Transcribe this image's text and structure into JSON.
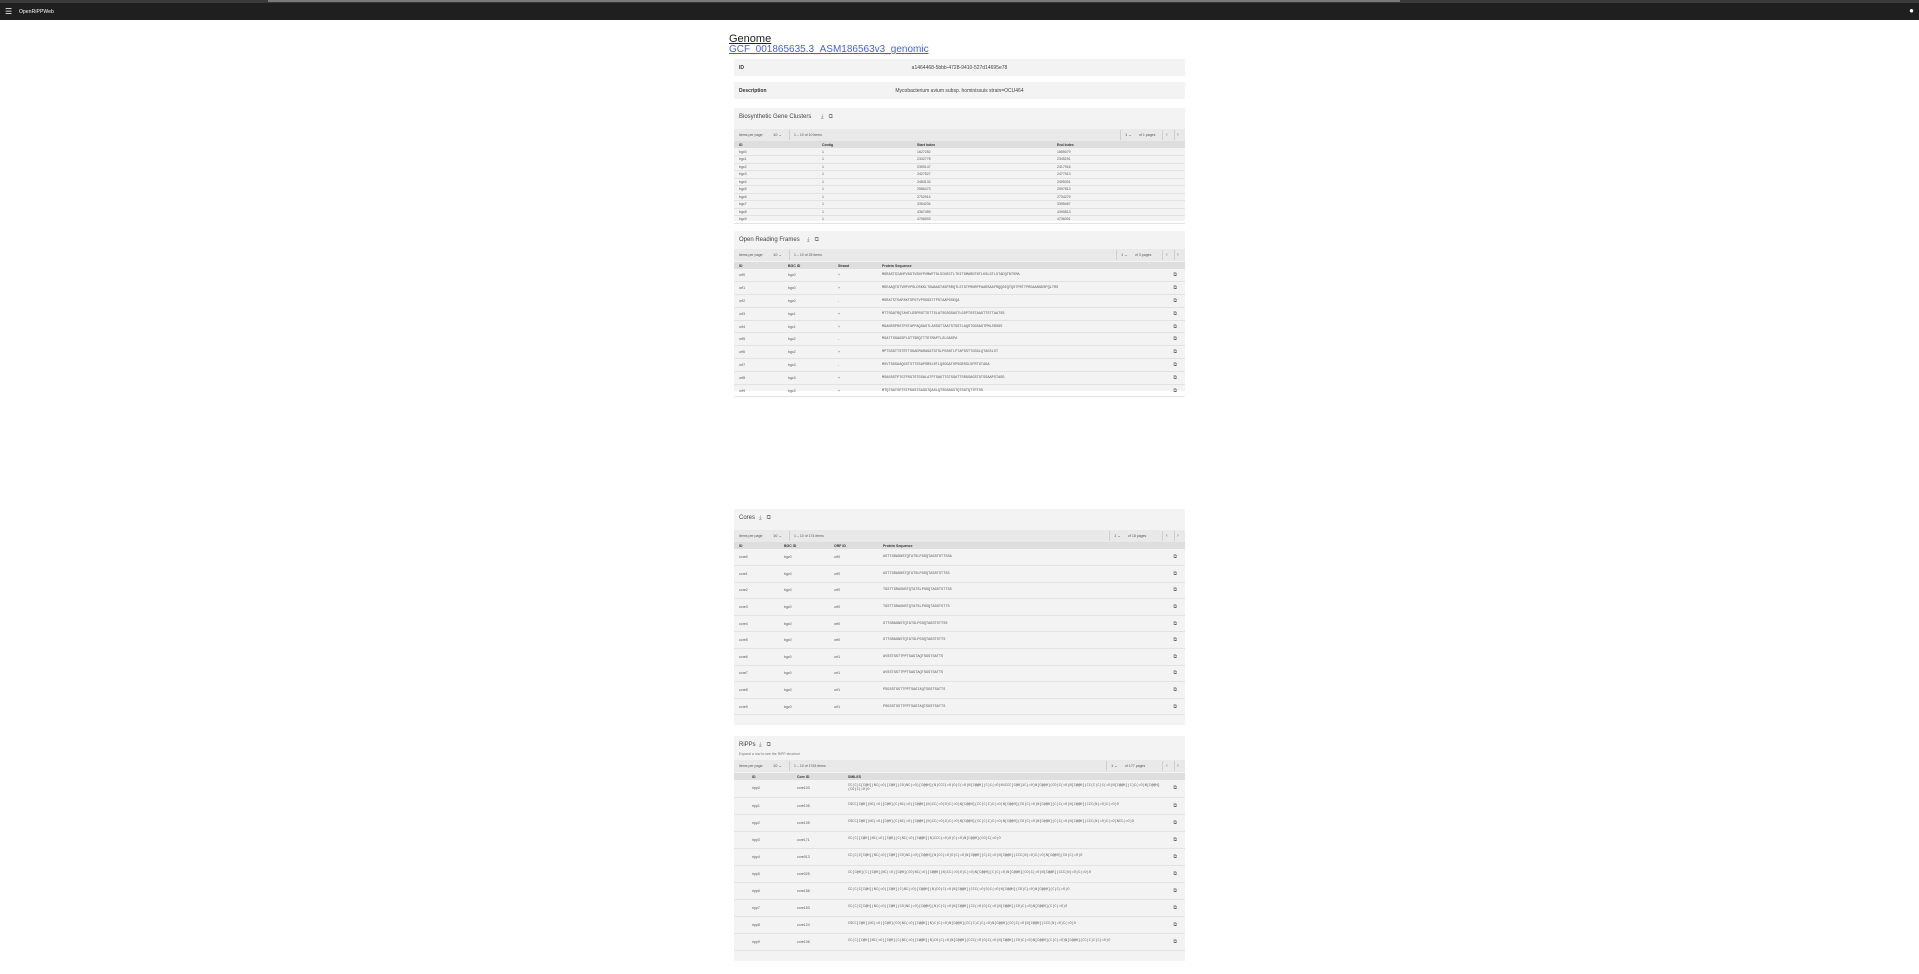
{
  "app": {
    "title": "OpenRiPPWeb"
  },
  "header": {
    "heading": "Genome",
    "genome_link": "GCF_001865635.3_ASM186563v3_genomic"
  },
  "fields": {
    "id_label": "ID",
    "id_value": "a1464468-5bbb-4728-9410-527d14695e78",
    "desc_label": "Description",
    "desc_value": "Mycobacterium avium subsp. hominissuis strain=OCU464"
  },
  "bgc": {
    "title": "Biosynthetic Gene Clusters",
    "pager": {
      "per_label": "Items per page:",
      "per_value": "10",
      "range": "1 – 10 of 10 items",
      "page": "1",
      "of": "of 1 pages"
    },
    "columns": [
      "ID",
      "Contig",
      "Start Index",
      "End Index"
    ],
    "rows": [
      [
        "bgc0",
        "1",
        "1627252",
        "1655079"
      ],
      [
        "bgc1",
        "1",
        "2332778",
        "2345291"
      ],
      [
        "bgc2",
        "1",
        "2359147",
        "2417916"
      ],
      [
        "bgc3",
        "1",
        "2427527",
        "2477913"
      ],
      [
        "bgc4",
        "1",
        "2483133",
        "2495301"
      ],
      [
        "bgc5",
        "1",
        "2586473",
        "2597813"
      ],
      [
        "bgc6",
        "1",
        "2702914",
        "2734279"
      ],
      [
        "bgc7",
        "1",
        "3354234",
        "3395467"
      ],
      [
        "bgc8",
        "1",
        "4367459",
        "4390813"
      ],
      [
        "bgc9",
        "1",
        "4706003",
        "4736301"
      ]
    ]
  },
  "orf": {
    "title": "Open Reading Frames",
    "pager": {
      "per_label": "Items per page:",
      "per_value": "10",
      "range": "1 – 10 of 25 items",
      "page": "1",
      "of": "of 3 pages"
    },
    "columns": [
      "ID",
      "BGC ID",
      "Strand",
      "Protein Sequence"
    ],
    "rows": [
      [
        "orf0",
        "bgc0",
        "+",
        "MDRASTSIAHPVGGTVSNYPVMWFTGLSCNSCTLTHITGMARNTNTLKSLGTLSTADQTNTSMA"
      ],
      [
        "orf1",
        "bgc0",
        "+",
        "MDEAAQTGTVRPVPSLDSKKLTGWAAGTASPSRQTLSTGTPRNRPPAARSAAFRQQGEQTQSTPRTTPRGAANGDSPQLTRS"
      ],
      [
        "orf2",
        "bgc0",
        "-",
        "MSRATSTSAPAKTSPGTVPSSGSTTPSTAAPGSEQA"
      ],
      [
        "orf3",
        "bgc1",
        "+",
        "MTTSGATRQTAHTLDSPRGTTDTTSLATSGSGSASTLGSPTSSTAAGTTSTTAATSS"
      ],
      [
        "orf4",
        "bgc1",
        "+",
        "MGANSSPRSTPSTAPPAQSAGTLASSGTTAATSTGSTLAQSTGGSAGTPMLSRSGS"
      ],
      [
        "orf5",
        "bgc2",
        "-",
        "MSATTSSAGSPLGTTSRQTTTDTMAPTLSLGASPA"
      ],
      [
        "orf6",
        "bgc2",
        "+",
        "MPTGSGTTSTRTTSGAEMARAGATGTSLPGSNTLPTAPSSTTGSGLQTAGSLST"
      ],
      [
        "orf7",
        "bgc3",
        "-",
        "MSVTSGSAAQGSTSTTSSAPSRSLRTLQSGGATSPSGRSSLSPRTGTAGA"
      ],
      [
        "orf8",
        "bgc3",
        "+",
        "MSAGSSTPTGTPSGTSTGSALATPTSAGTTGTSGATTSRGSAGSTGTSSAAPSTASG"
      ],
      [
        "orf9",
        "bgc3",
        "+",
        "MTQTSATSPTSTPSGSTSASGTQASLQTSGSAGSTQTSGTQTTPTSS"
      ]
    ]
  },
  "cores": {
    "title": "Cores",
    "pager": {
      "per_label": "Items per page:",
      "per_value": "10",
      "range": "1 – 10 of 174 items",
      "page": "1",
      "of": "of 18 pages"
    },
    "columns": [
      "ID",
      "BGC ID",
      "ORF ID",
      "Protein Sequence"
    ],
    "rows": [
      [
        "core0",
        "bgc0",
        "orf0",
        "ASTTGRAGNSTQTATSLPGSQTAGSTSTTSSA"
      ],
      [
        "core1",
        "bgc0",
        "orf0",
        "ASTTGRAGNSTQTATSLPGSQTAGSTSTTSS"
      ],
      [
        "core2",
        "bgc0",
        "orf0",
        "TGSTTGRAGNSTQTATSLPGSQTAGSTSTTSS"
      ],
      [
        "core3",
        "bgc0",
        "orf0",
        "TGSTTGRAGNSTQTATSLPGSQTAGSTSTTS"
      ],
      [
        "core4",
        "bgc0",
        "orf0",
        "GTTGRAGNSTQTATSLPGSQTAGSTSTTSS"
      ],
      [
        "core5",
        "bgc0",
        "orf0",
        "GTTGRAGNSTQTATSLPGSQTAGSTSTTS"
      ],
      [
        "core6",
        "bgc0",
        "orf1",
        "AVSSTGSTTPPTSAGTAQTSGSTSATTS"
      ],
      [
        "core7",
        "bgc0",
        "orf1",
        "AVSSTGSTTPPTSAGTAQTSGSTSATTS"
      ],
      [
        "core8",
        "bgc0",
        "orf1",
        "PSGSSTGSTTPPTSAGTAQTSGSTSATTS"
      ],
      [
        "core9",
        "bgc0",
        "orf1",
        "PSGSSTGSTTPPTSAGTAQTSGSTSATTS"
      ]
    ]
  },
  "ripps": {
    "title": "RiPPs",
    "subtitle": "Expand a row to see the RiPP structure",
    "pager": {
      "per_label": "Items per page:",
      "per_value": "10",
      "range": "1 – 10 of 1763 items",
      "page": "1",
      "of": "of 177 pages"
    },
    "columns": [
      "ID",
      "Core ID",
      "SMILES"
    ],
    "rows": [
      [
        "ripp0",
        "core103",
        "CC(C)C[C@H](NC(=O)[C@H](CO)NC(=O)[C@@H](N)CCC(=O)O)C(=O)N[C@@H](C)C(=O)N1CCC[C@H]1C(=O)N[C@@H](CO)C(=O)N[C@@H](CC(C)C)C(=O)N[C@@H](C)C(=O)N[C@@H](CO)C(=O)O"
      ],
      [
        "ripp1",
        "core105",
        "CSCC[C@H](NC(=O)[C@H](C)NC(=O)[C@@H](N)CC(=O)O)C(=O)N[C@@H](CC(C)C)C(=O)N[C@@H](CO)C(=O)N[C@@H](C)C(=O)N[C@@H](CCC(N)=O)C(=O)O"
      ],
      [
        "ripp2",
        "core105",
        "CSCC[C@H](NC(=O)[C@H](C)NC(=O)[C@@H](N)CC(=O)O)C(=O)N[C@@H](CC(C)C)C(=O)N[C@@H](CO)C(=O)N[C@@H](C)C(=O)N[C@@H](CCC(N)=O)C(=O)NCC(=O)O"
      ],
      [
        "ripp3",
        "core171",
        "CC(C)[C@H](NC(=O)[C@H](C)NC(=O)[C@@H](N)CCC(=O)O)C(=O)N[C@@H](CO)C(=O)O"
      ],
      [
        "ripp4",
        "core013",
        "CC(C)C[C@H](NC(=O)[C@H](CO)NC(=O)[C@@H](N)CC(=O)O)C(=O)N[C@@H](C)C(=O)N[C@@H](CCC(N)=O)C(=O)N[C@@H](CO)C(=O)O"
      ],
      [
        "ripp5",
        "core025",
        "CC[C@H](C)[C@H](NC(=O)[C@H](CO)NC(=O)[C@@H](N)CC(=O)O)C(=O)N[C@@H](C)C(=O)N[C@@H](CO)C(=O)N[C@@H](CCC(N)=O)C(=O)O"
      ],
      [
        "ripp6",
        "core156",
        "CC(C)C[C@H](NC(=O)[C@H](C)NC(=O)[C@@H](N)CO)C(=O)N[C@@H](CCC(=O)O)C(=O)N[C@@H](CO)C(=O)N[C@@H](C)C(=O)O"
      ],
      [
        "ripp7",
        "core153",
        "CC(C)C[C@H](NC(=O)[C@H](CO)NC(=O)[C@@H](N)C)C(=O)N[C@@H](CC(=O)O)C(=O)N[C@@H](CO)C(=O)N[C@@H](C)C(=O)O"
      ],
      [
        "ripp8",
        "core124",
        "CSCC[C@H](NC(=O)[C@H](CO)NC(=O)[C@@H](N)C)C(=O)N[C@@H](CC(C)C)C(=O)N[C@@H](CO)C(=O)N[C@@H](CCC(N)=O)C(=O)O"
      ],
      [
        "ripp9",
        "core106",
        "CC(C)[C@H](NC(=O)[C@H](C)NC(=O)[C@@H](N)CO)C(=O)N[C@@H](CCC(=O)O)C(=O)N[C@@H](CO)C(=O)N[C@@H](C)C(=O)N[C@@H](CC(C)C)C(=O)O"
      ]
    ]
  }
}
